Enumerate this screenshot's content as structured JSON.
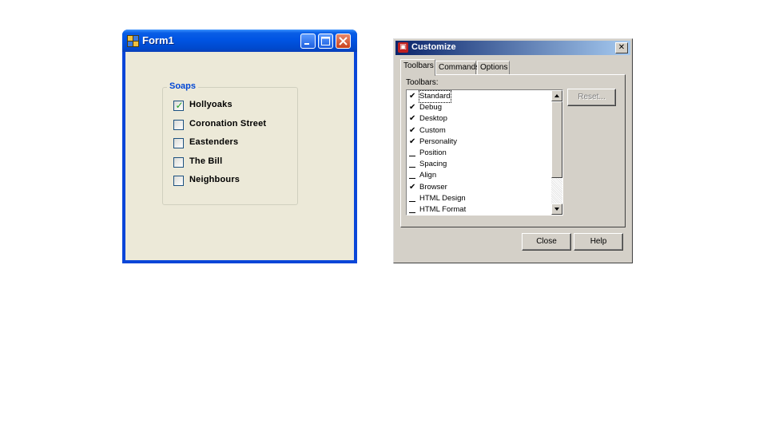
{
  "form1": {
    "title": "Form1",
    "groupbox_title": "Soaps",
    "items": [
      {
        "label": "Hollyoaks",
        "checked": true
      },
      {
        "label": "Coronation Street",
        "checked": false
      },
      {
        "label": "Eastenders",
        "checked": false
      },
      {
        "label": "The Bill",
        "checked": false
      },
      {
        "label": "Neighbours",
        "checked": false
      }
    ]
  },
  "customize": {
    "title": "Customize",
    "tabs": [
      "Toolbars",
      "Commands",
      "Options"
    ],
    "list_label": "Toolbars:",
    "toolbars": [
      {
        "label": "Standard",
        "checked": true
      },
      {
        "label": "Debug",
        "checked": true
      },
      {
        "label": "Desktop",
        "checked": true
      },
      {
        "label": "Custom",
        "checked": true
      },
      {
        "label": "Personality",
        "checked": true
      },
      {
        "label": "Position",
        "checked": false
      },
      {
        "label": "Spacing",
        "checked": false
      },
      {
        "label": "Align",
        "checked": false
      },
      {
        "label": "Browser",
        "checked": true
      },
      {
        "label": "HTML Design",
        "checked": false
      },
      {
        "label": "HTML Format",
        "checked": false
      }
    ],
    "reset_label": "Reset...",
    "close_label": "Close",
    "help_label": "Help",
    "close_x": "✕"
  },
  "colors": {
    "xp_title_blue": "#0054e3",
    "xp_face": "#ece9d8",
    "classic_face": "#d4d0c8",
    "classic_title": "#0a246a",
    "check_green": "#21a121"
  }
}
